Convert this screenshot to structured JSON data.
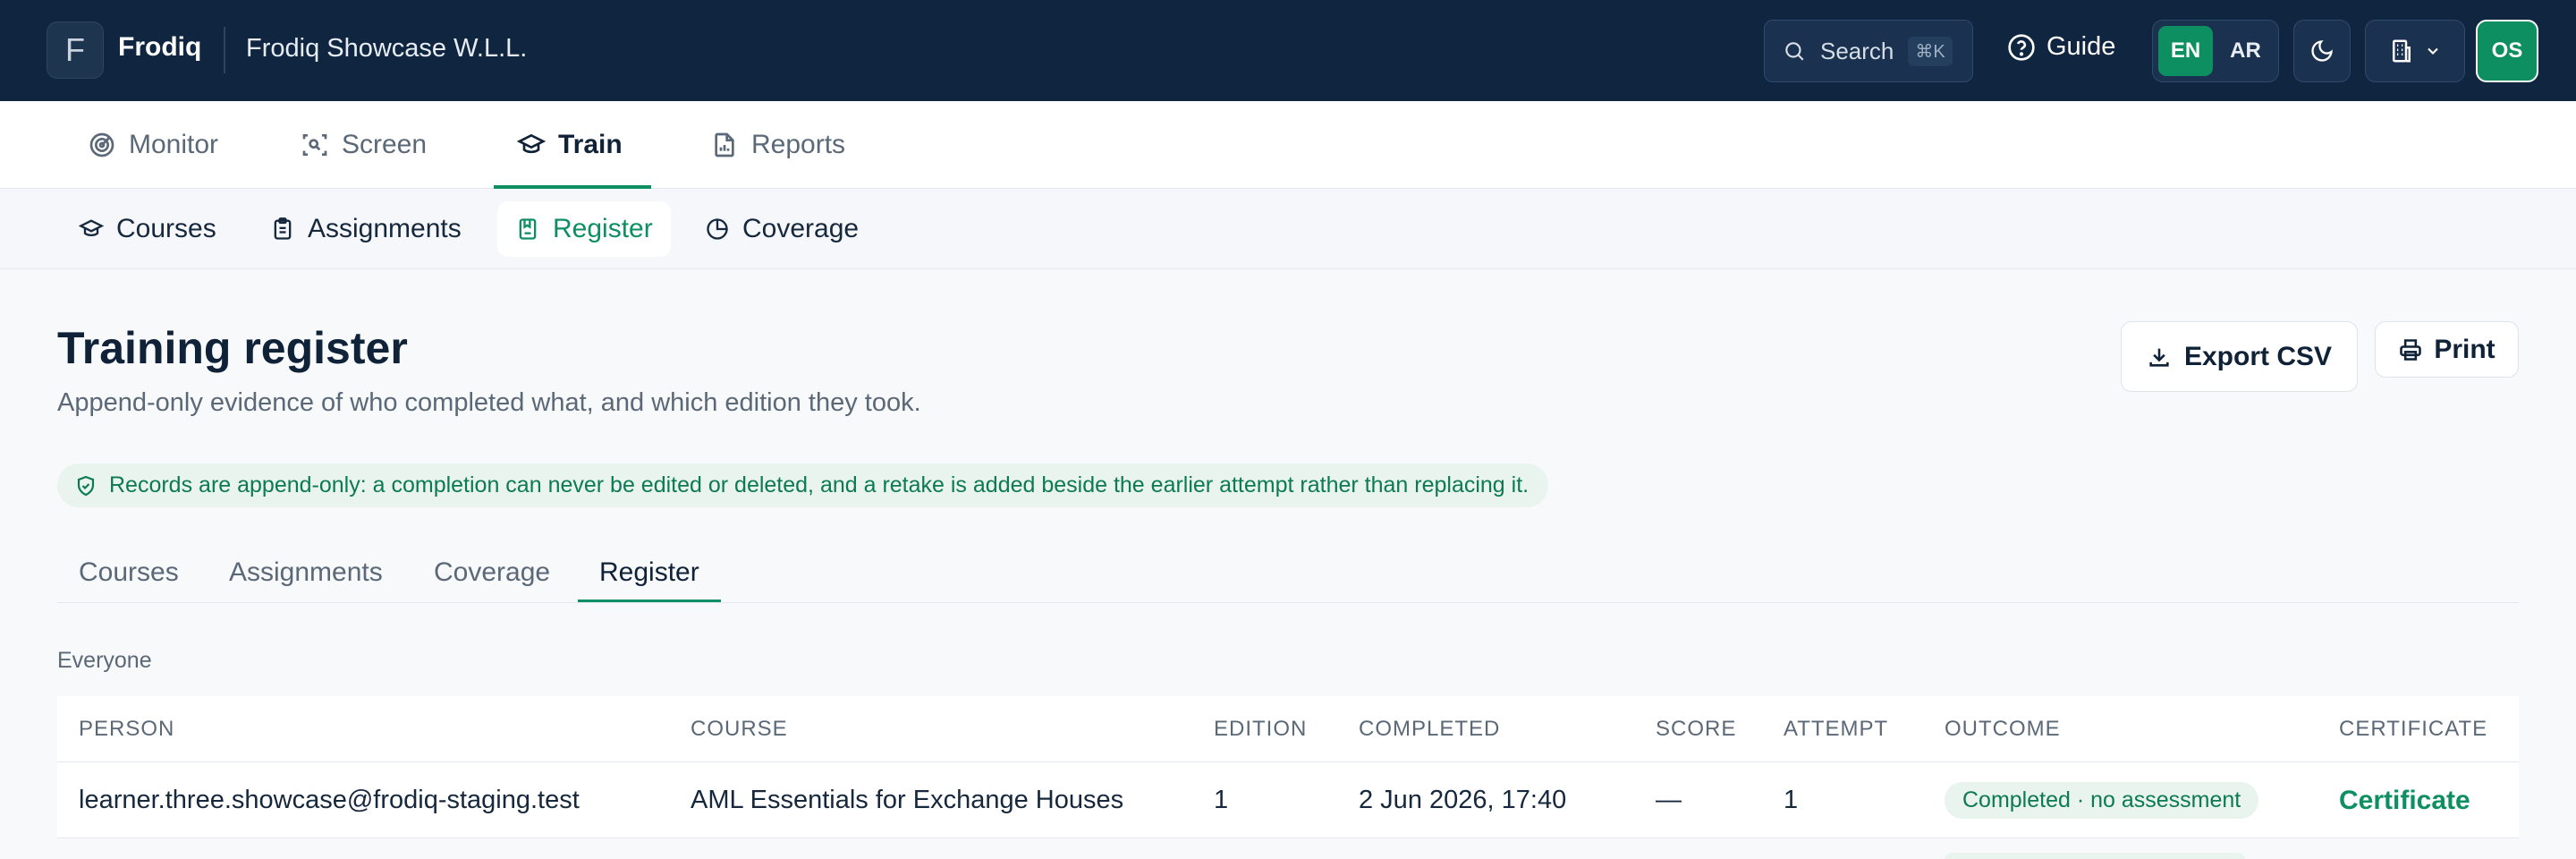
{
  "header": {
    "logo_letter": "F",
    "brand": "Frodiq",
    "org_name": "Frodiq Showcase W.L.L.",
    "search_label": "Search",
    "search_shortcut": "⌘K",
    "guide_label": "Guide",
    "languages": [
      {
        "code": "EN",
        "active": true
      },
      {
        "code": "AR",
        "active": false
      }
    ],
    "user_initials": "OS"
  },
  "primary_nav": {
    "items": [
      {
        "label": "Monitor",
        "icon": "radar-icon",
        "active": false
      },
      {
        "label": "Screen",
        "icon": "scan-face-icon",
        "active": false
      },
      {
        "label": "Train",
        "icon": "graduation-cap-icon",
        "active": true
      },
      {
        "label": "Reports",
        "icon": "file-chart-icon",
        "active": false
      }
    ]
  },
  "sub_nav": {
    "items": [
      {
        "label": "Courses",
        "icon": "graduation-cap-icon",
        "active": false
      },
      {
        "label": "Assignments",
        "icon": "clipboard-list-icon",
        "active": false
      },
      {
        "label": "Register",
        "icon": "book-bookmark-icon",
        "active": true
      },
      {
        "label": "Coverage",
        "icon": "pie-chart-icon",
        "active": false
      }
    ]
  },
  "page": {
    "title": "Training register",
    "subtitle": "Append-only evidence of who completed what, and which edition they took.",
    "export_label": "Export CSV",
    "print_label": "Print",
    "notice": "Records are append-only: a completion can never be edited or deleted, and a retake is added beside the earlier attempt rather than replacing it."
  },
  "tabs": [
    {
      "label": "Courses",
      "active": false
    },
    {
      "label": "Assignments",
      "active": false
    },
    {
      "label": "Coverage",
      "active": false
    },
    {
      "label": "Register",
      "active": true
    }
  ],
  "register": {
    "scope_label": "Everyone",
    "columns": [
      "PERSON",
      "COURSE",
      "EDITION",
      "COMPLETED",
      "SCORE",
      "ATTEMPT",
      "OUTCOME",
      "CERTIFICATE"
    ],
    "rows": [
      {
        "person": "learner.three.showcase@frodiq-staging.test",
        "course": "AML Essentials for Exchange Houses",
        "edition": "1",
        "completed": "2 Jun 2026, 17:40",
        "score": "—",
        "attempt": "1",
        "outcome": "Completed · no assessment",
        "certificate": "Certificate"
      }
    ]
  },
  "colors": {
    "header_bg": "#0f2540",
    "accent": "#0e8f62",
    "accent_soft": "#e9f4ef"
  }
}
